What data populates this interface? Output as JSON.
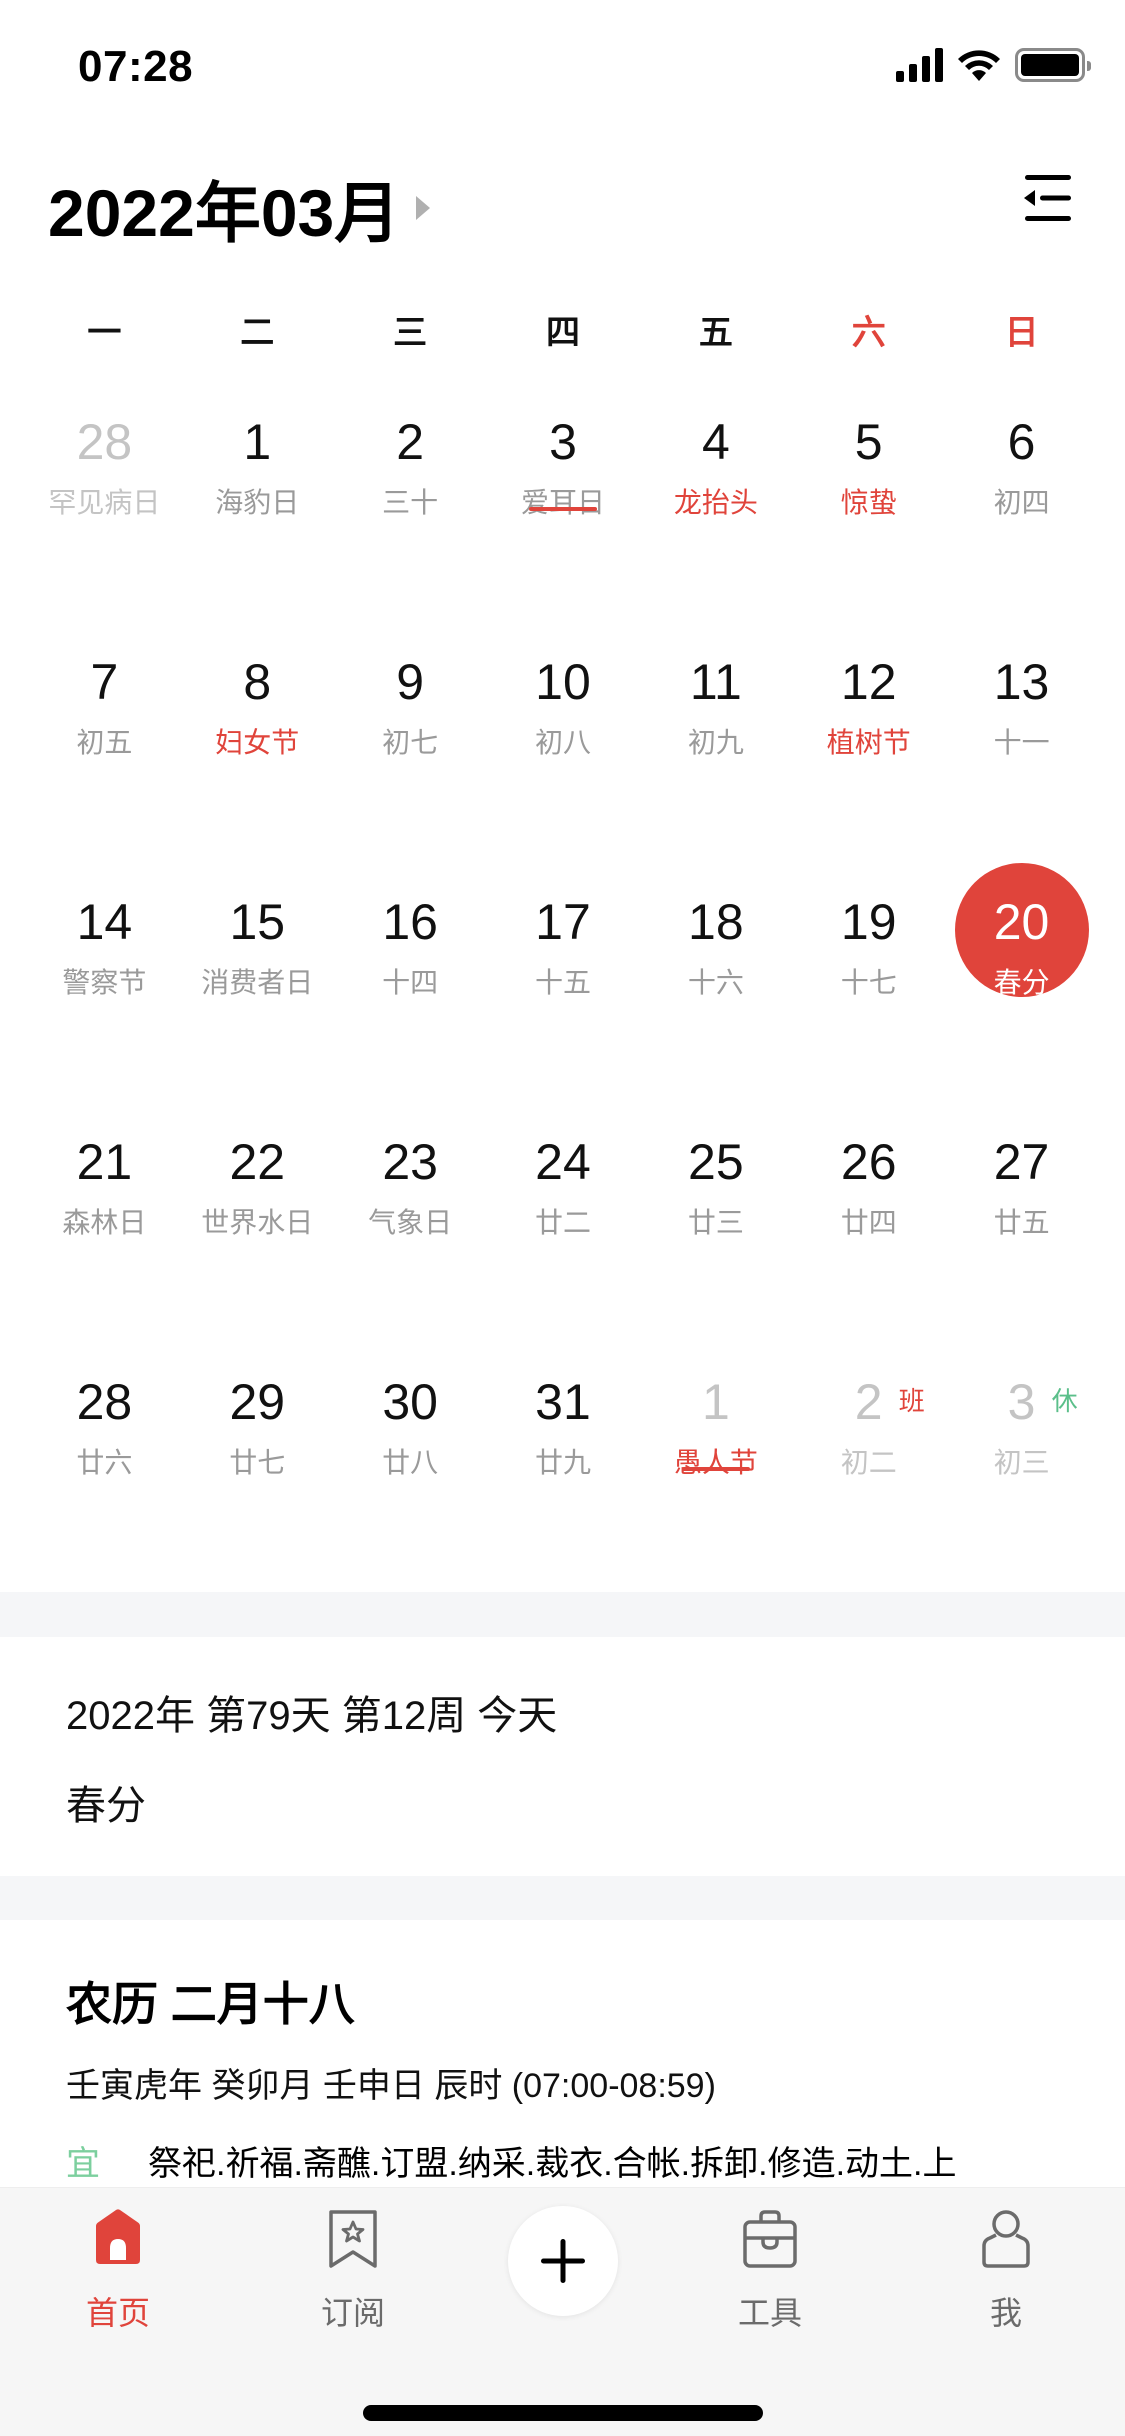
{
  "status_bar": {
    "time": "07:28"
  },
  "header": {
    "title": "2022年03月"
  },
  "weekdays": [
    "一",
    "二",
    "三",
    "四",
    "五",
    "六",
    "日"
  ],
  "colors": {
    "accent_red": "#e0443b",
    "rest_green": "#5bbf8a",
    "muted_gray": "#9a9a9a",
    "faded_gray": "#c4c4c4",
    "separator_bg": "#f5f6f8"
  },
  "calendar": {
    "today": 20,
    "weeks": [
      [
        {
          "day": "28",
          "sub": "罕见病日",
          "other_month": true
        },
        {
          "day": "1",
          "sub": "海豹日"
        },
        {
          "day": "2",
          "sub": "三十"
        },
        {
          "day": "3",
          "sub": "爱耳日",
          "underline": true
        },
        {
          "day": "4",
          "sub": "龙抬头",
          "sub_red": true
        },
        {
          "day": "5",
          "sub": "惊蛰",
          "sub_red": true
        },
        {
          "day": "6",
          "sub": "初四"
        }
      ],
      [
        {
          "day": "7",
          "sub": "初五"
        },
        {
          "day": "8",
          "sub": "妇女节",
          "sub_red": true
        },
        {
          "day": "9",
          "sub": "初七"
        },
        {
          "day": "10",
          "sub": "初八"
        },
        {
          "day": "11",
          "sub": "初九"
        },
        {
          "day": "12",
          "sub": "植树节",
          "sub_red": true
        },
        {
          "day": "13",
          "sub": "十一"
        }
      ],
      [
        {
          "day": "14",
          "sub": "警察节"
        },
        {
          "day": "15",
          "sub": "消费者日"
        },
        {
          "day": "16",
          "sub": "十四"
        },
        {
          "day": "17",
          "sub": "十五"
        },
        {
          "day": "18",
          "sub": "十六"
        },
        {
          "day": "19",
          "sub": "十七"
        },
        {
          "day": "20",
          "sub": "春分",
          "today": true
        }
      ],
      [
        {
          "day": "21",
          "sub": "森林日"
        },
        {
          "day": "22",
          "sub": "世界水日"
        },
        {
          "day": "23",
          "sub": "气象日"
        },
        {
          "day": "24",
          "sub": "廿二"
        },
        {
          "day": "25",
          "sub": "廿三"
        },
        {
          "day": "26",
          "sub": "廿四"
        },
        {
          "day": "27",
          "sub": "廿五"
        }
      ],
      [
        {
          "day": "28",
          "sub": "廿六"
        },
        {
          "day": "29",
          "sub": "廿七"
        },
        {
          "day": "30",
          "sub": "廿八"
        },
        {
          "day": "31",
          "sub": "廿九"
        },
        {
          "day": "1",
          "sub": "愚人节",
          "other_month": true,
          "sub_red": true,
          "underline": true
        },
        {
          "day": "2",
          "sub": "初二",
          "other_month": true,
          "badge": "班",
          "badge_type": "work"
        },
        {
          "day": "3",
          "sub": "初三",
          "other_month": true,
          "badge": "休",
          "badge_type": "rest"
        }
      ]
    ]
  },
  "info": {
    "summary": "2022年 第79天 第12周 今天",
    "solar_term": "春分"
  },
  "lunar": {
    "title": "农历 二月十八",
    "ganzhi": "壬寅虎年 癸卯月 壬申日 辰时 (07:00-08:59)",
    "yi_label": "宜",
    "yi_text": "祭祀.祈福.斋醮.订盟.纳采.裁衣.合帐.拆卸.修造.动土.上"
  },
  "tabbar": {
    "tabs": [
      {
        "label": "首页",
        "icon": "home-icon",
        "active": true
      },
      {
        "label": "订阅",
        "icon": "bookmark-star-icon"
      },
      {
        "label": "",
        "icon": "plus-icon"
      },
      {
        "label": "工具",
        "icon": "toolbox-icon"
      },
      {
        "label": "我",
        "icon": "user-icon"
      }
    ]
  }
}
